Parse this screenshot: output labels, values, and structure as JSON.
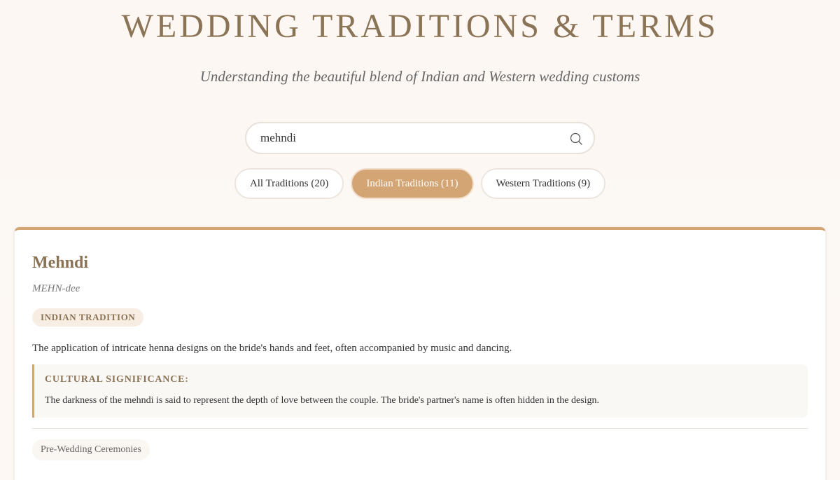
{
  "header": {
    "title": "WEDDING TRADITIONS & TERMS",
    "subtitle": "Understanding the beautiful blend of Indian and Western wedding customs"
  },
  "search": {
    "value": "mehndi",
    "icon": "search-icon"
  },
  "filters": [
    {
      "label": "All Traditions (20)",
      "active": false
    },
    {
      "label": "Indian Traditions (11)",
      "active": true
    },
    {
      "label": "Western Traditions (9)",
      "active": false
    }
  ],
  "card": {
    "term": "Mehndi",
    "pronunciation": "MEHN-dee",
    "badge": "INDIAN TRADITION",
    "description": "The application of intricate henna designs on the bride's hands and feet, often accompanied by music and dancing.",
    "significance_label": "CULTURAL SIGNIFICANCE:",
    "significance_text": "The darkness of the mehndi is said to represent the depth of love between the couple. The bride's partner's name is often hidden in the design.",
    "category": "Pre-Wedding Ceremonies"
  },
  "colors": {
    "accent": "#d4a574",
    "title": "#8b7355"
  }
}
